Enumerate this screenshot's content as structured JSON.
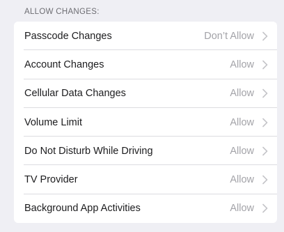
{
  "section": {
    "header": "ALLOW CHANGES:"
  },
  "rows": [
    {
      "label": "Passcode Changes",
      "value": "Don’t Allow"
    },
    {
      "label": "Account Changes",
      "value": "Allow"
    },
    {
      "label": "Cellular Data Changes",
      "value": "Allow"
    },
    {
      "label": "Volume Limit",
      "value": "Allow"
    },
    {
      "label": "Do Not Disturb While Driving",
      "value": "Allow"
    },
    {
      "label": "TV Provider",
      "value": "Allow"
    },
    {
      "label": "Background App Activities",
      "value": "Allow"
    }
  ],
  "icons": {
    "disclosure": "chevron-right-icon"
  },
  "colors": {
    "background": "#efeff4",
    "card": "#ffffff",
    "label": "#1c1c1e",
    "value": "#a3a3a8",
    "header": "#6d6d72",
    "separator": "#dcdce0"
  }
}
